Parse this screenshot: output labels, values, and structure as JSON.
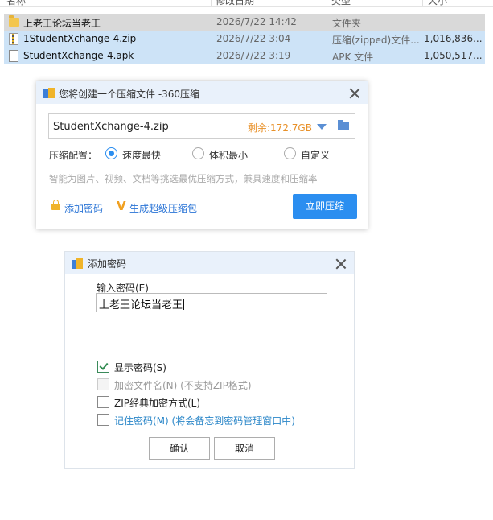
{
  "explorer": {
    "columns": [
      "名称",
      "修改日期",
      "类型",
      "大小"
    ],
    "rows": [
      {
        "name": "上老王论坛当老王",
        "date": "2026/7/22 14:42",
        "type": "文件夹",
        "size": "",
        "icon": "folder-icon"
      },
      {
        "name": "1StudentXchange-4.zip",
        "date": "2026/7/22 3:04",
        "type": "压缩(zipped)文件...",
        "size": "1,016,836...",
        "icon": "zip-file-icon"
      },
      {
        "name": "StudentXchange-4.apk",
        "date": "2026/7/22 3:19",
        "type": "APK 文件",
        "size": "1,050,517...",
        "icon": "document-icon"
      }
    ]
  },
  "compress_dialog": {
    "title": "您将创建一个压缩文件 -360压缩",
    "filename": "StudentXchange-4.zip",
    "free_space": "剩余:172.7GB",
    "config_label": "压缩配置：",
    "options": [
      "速度最快",
      "体积最小",
      "自定义"
    ],
    "selected_option": "速度最快",
    "hint": "智能为图片、视频、文档等挑选最优压缩方式，兼具速度和压缩率",
    "add_password_link": "添加密码",
    "super_zip_link": "生成超级压缩包",
    "compress_button": "立即压缩",
    "accent_color": "#2b8ef0"
  },
  "password_dialog": {
    "title": "添加密码",
    "input_label": "输入密码(E)",
    "password_value": "上老王论坛当老王",
    "checkboxes": [
      {
        "label": "显示密码(S)",
        "checked": true,
        "enabled": true
      },
      {
        "label": "加密文件名(N) (不支持ZIP格式)",
        "checked": false,
        "enabled": false
      },
      {
        "label": "ZIP经典加密方式(L)",
        "checked": false,
        "enabled": true
      },
      {
        "label": "记住密码(M) (将会备忘到密码管理窗口中)",
        "checked": false,
        "enabled": true
      }
    ],
    "ok_button": "确认",
    "cancel_button": "取消"
  }
}
